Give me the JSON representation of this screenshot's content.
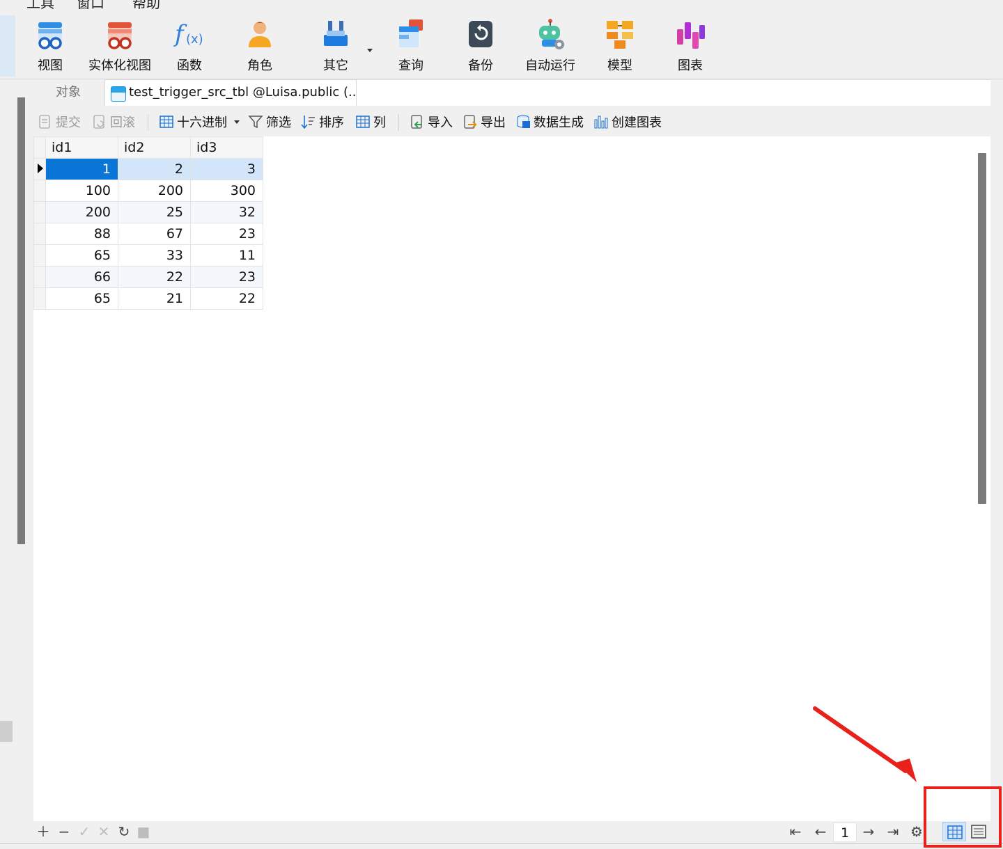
{
  "menu": {
    "items": [
      "工具",
      "窗口",
      "帮助"
    ]
  },
  "ribbon": {
    "buttons": [
      {
        "label": "视图",
        "icon": "view-icon"
      },
      {
        "label": "实体化视图",
        "icon": "materialized-view-icon"
      },
      {
        "label": "函数",
        "icon": "function-icon"
      },
      {
        "label": "角色",
        "icon": "role-icon"
      },
      {
        "label": "其它",
        "icon": "others-icon"
      },
      {
        "label": "查询",
        "icon": "query-icon"
      },
      {
        "label": "备份",
        "icon": "backup-icon"
      },
      {
        "label": "自动运行",
        "icon": "automation-robot-icon"
      },
      {
        "label": "模型",
        "icon": "model-icon"
      },
      {
        "label": "图表",
        "icon": "chart-icon"
      }
    ]
  },
  "tabs": {
    "objects_label": "对象",
    "active_label": "test_trigger_src_tbl @Luisa.public (..."
  },
  "toolbar": {
    "commit": "提交",
    "rollback": "回滚",
    "hex": "十六进制",
    "filter": "筛选",
    "sort": "排序",
    "columns": "列",
    "import": "导入",
    "export": "导出",
    "data_gen": "数据生成",
    "create_chart": "创建图表"
  },
  "grid": {
    "columns": [
      "id1",
      "id2",
      "id3"
    ],
    "rows": [
      [
        "1",
        "2",
        "3"
      ],
      [
        "100",
        "200",
        "300"
      ],
      [
        "200",
        "25",
        "32"
      ],
      [
        "88",
        "67",
        "23"
      ],
      [
        "65",
        "33",
        "11"
      ],
      [
        "66",
        "22",
        "23"
      ],
      [
        "65",
        "21",
        "22"
      ]
    ],
    "selected_row": 0
  },
  "pager": {
    "page": "1"
  },
  "colors": {
    "selection": "#0a76d7",
    "selection_row": "#d3e5f8",
    "highlight_box": "#e8211b"
  }
}
